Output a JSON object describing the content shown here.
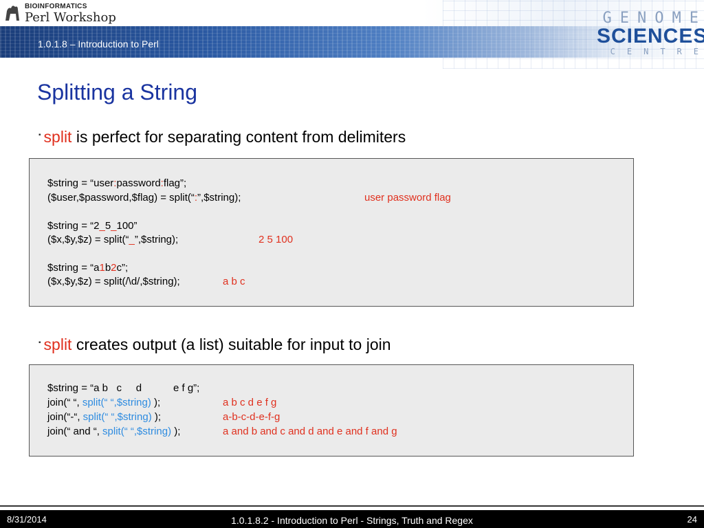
{
  "header": {
    "logo_small": "BIOINFORMATICS",
    "logo_big": "Perl Workshop",
    "subtitle": "1.0.1.8 – Introduction to Perl",
    "gsc_line1": "GENOME",
    "gsc_line2": "SCIENCES",
    "gsc_line3": "CENTRE"
  },
  "slide": {
    "title": "Splitting a String",
    "bullet1": {
      "keyword": "split",
      "text": " is perfect for separating content from delimiters"
    },
    "bullet2": {
      "keyword": "split",
      "text": " creates output (a list) suitable for input to join"
    }
  },
  "box1": {
    "l1a": "$string = “user",
    "l1b": ":",
    "l1c": "password",
    "l1d": ":",
    "l1e": "flag”;",
    "l2a": "($user,$password,$flag) = split(“",
    "l2b": ":",
    "l2c": "”,$string);",
    "l2out": "user password flag",
    "l3a": "$string = “2",
    "l3b": "_",
    "l3c": "5",
    "l3d": "_",
    "l3e": "100”",
    "l4a": "($x,$y,$z) = split(“",
    "l4b": "_",
    "l4c": "”,$string);",
    "l4out": "2 5 100",
    "l5a": "$string = “a",
    "l5b": "1",
    "l5c": "b",
    "l5d": "2",
    "l5e": "c”;",
    "l6a": "($x,$y,$z) = split(/\\d/,$string);",
    "l6out": "a b c"
  },
  "box2": {
    "l1": "$string = “a b   c     d           e f g”;",
    "l2a": "join(“ “, ",
    "l2b": "split(“ “,$string)",
    "l2c": " );",
    "l2out": "a b c d e f g",
    "l3a": "join(“-“, ",
    "l3b": "split(“ “,$string)",
    "l3c": " );",
    "l3out": "a-b-c-d-e-f-g",
    "l4a": "join(“ and “, ",
    "l4b": "split(“ “,$string)",
    "l4c": " );",
    "l4out": "a and b and c and d and e and f and g"
  },
  "footer": {
    "date": "8/31/2014",
    "center": "1.0.1.8.2 - Introduction to Perl - Strings, Truth and Regex",
    "page": "24"
  },
  "colors": {
    "title": "#1a34a0",
    "keyword": "#e0301e",
    "split_call": "#2f8ce0"
  }
}
